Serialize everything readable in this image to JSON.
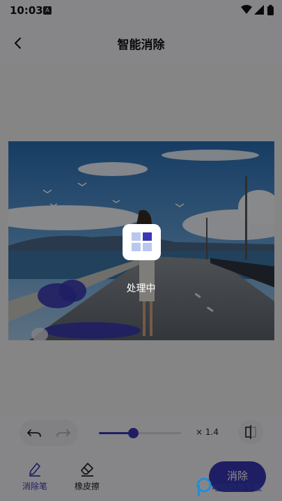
{
  "status_bar": {
    "time": "10:03",
    "notification_icon": "app-notification-icon",
    "icons": [
      "wifi-icon",
      "signal-icon",
      "battery-icon"
    ]
  },
  "header": {
    "title": "智能消除",
    "back_icon": "back-chevron-icon"
  },
  "photo": {
    "description_icon": "photo-image",
    "strokes_color": "#3a37b6"
  },
  "controls": {
    "undo_icon": "undo-icon",
    "redo_icon": "redo-icon",
    "brush_size_fraction": 0.42,
    "zoom_label": "× 1.4",
    "compare_icon": "compare-icon"
  },
  "tools": [
    {
      "label": "消除笔",
      "icon": "brush-pen-icon",
      "active": true
    },
    {
      "label": "橡皮擦",
      "icon": "eraser-icon",
      "active": false
    }
  ],
  "apply_button": "消除",
  "modal": {
    "processing_text": "处理中",
    "icon": "grid-squares-icon"
  },
  "watermark": "电脑软件下载",
  "colors": {
    "accent": "#3a37b6",
    "overlay": "rgba(0,0,0,0.45)",
    "background": "#f5f5f7"
  }
}
